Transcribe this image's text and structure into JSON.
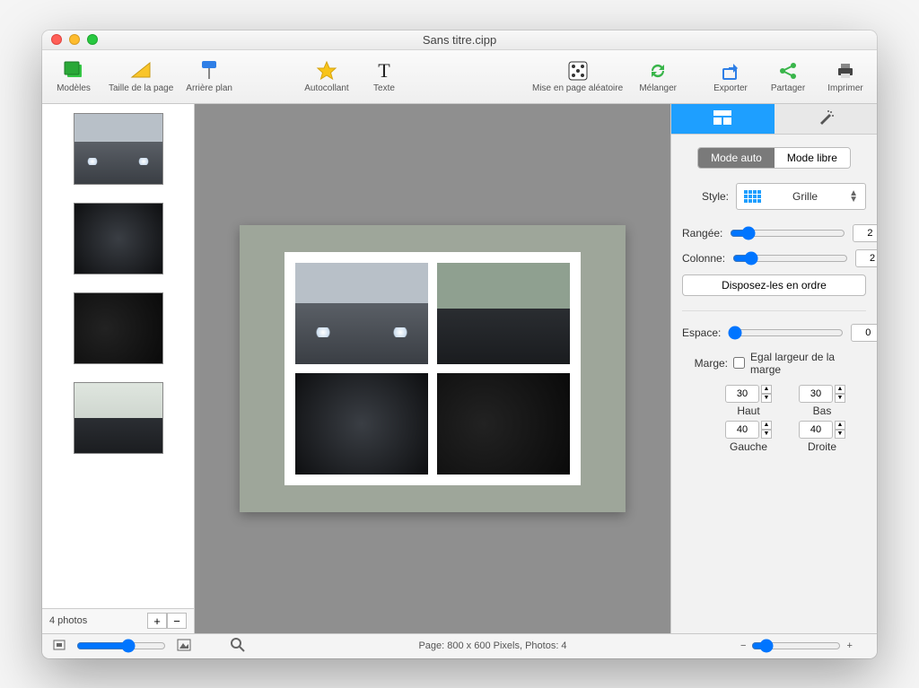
{
  "window": {
    "title": "Sans titre.cipp"
  },
  "toolbar": {
    "models": "Modèles",
    "pagesize": "Taille de la page",
    "background": "Arrière plan",
    "sticker": "Autocollant",
    "text": "Texte",
    "randomlayout": "Mise en page aléatoire",
    "shuffle": "Mélanger",
    "export": "Exporter",
    "share": "Partager",
    "print": "Imprimer"
  },
  "sidebar": {
    "count_label": "4 photos"
  },
  "canvas": {
    "grid": {
      "rows": 2,
      "cols": 2
    }
  },
  "inspector": {
    "mode_auto": "Mode auto",
    "mode_free": "Mode libre",
    "style_label": "Style:",
    "style_value": "Grille",
    "row_label": "Rangée:",
    "row_value": "2",
    "col_label": "Colonne:",
    "col_value": "2",
    "dispose": "Disposez-les en ordre",
    "space_label": "Espace:",
    "space_value": "0",
    "margin_label": "Marge:",
    "equal_label": "Egal largeur de la marge",
    "top_label": "Haut",
    "bottom_label": "Bas",
    "left_label": "Gauche",
    "right_label": "Droite",
    "top_value": "30",
    "bottom_value": "30",
    "left_value": "40",
    "right_value": "40"
  },
  "footer": {
    "page_info": "Page: 800 x 600 Pixels, Photos: 4"
  }
}
